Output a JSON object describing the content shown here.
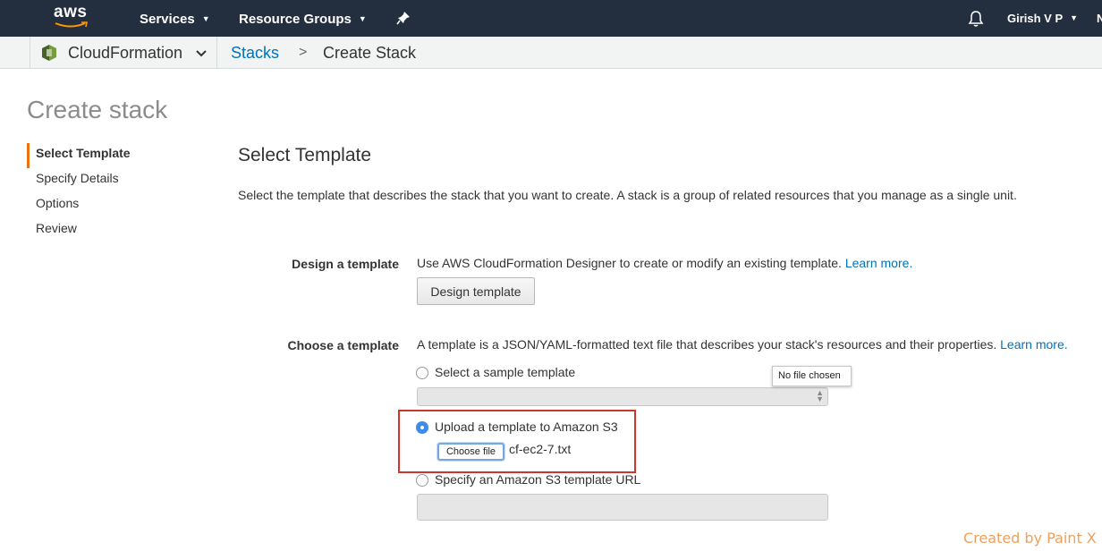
{
  "topbar": {
    "logo_text": "aws",
    "services_label": "Services",
    "resource_groups_label": "Resource Groups",
    "user_label": "Girish V P",
    "extra_label": "N",
    "icons": [
      "pin-icon",
      "bell-icon"
    ]
  },
  "subbar": {
    "service_name": "CloudFormation",
    "breadcrumb_link": "Stacks",
    "breadcrumb_separator": ">",
    "breadcrumb_current": "Create Stack"
  },
  "page": {
    "title": "Create stack"
  },
  "steps": [
    {
      "label": "Select Template",
      "active": true
    },
    {
      "label": "Specify Details",
      "active": false
    },
    {
      "label": "Options",
      "active": false
    },
    {
      "label": "Review",
      "active": false
    }
  ],
  "main": {
    "section_title": "Select Template",
    "section_desc": "Select the template that describes the stack that you want to create. A stack is a group of related resources that you manage as a single unit.",
    "design": {
      "label": "Design a template",
      "text": "Use AWS CloudFormation Designer to create or modify an existing template.",
      "learn_more": "Learn more.",
      "button_label": "Design template"
    },
    "choose": {
      "label": "Choose a template",
      "text": "A template is a JSON/YAML-formatted text file that describes your stack's resources and their properties.",
      "learn_more": "Learn more.",
      "options": {
        "sample_label": "Select a sample template",
        "upload_label": "Upload a template to Amazon S3",
        "url_label": "Specify an Amazon S3 template URL"
      },
      "selected_option": "Upload a template to Amazon S3",
      "choose_file_label": "Choose file",
      "file_name": "cf-ec2-7.txt",
      "tooltip": "No file chosen"
    }
  },
  "watermark": "Created by Paint X",
  "colors": {
    "navbar": "#232f3e",
    "link": "#0073bb",
    "active_step_accent": "#ec7211",
    "highlight_box": "#d0352b",
    "radio_selected": "#3d8ce8"
  }
}
